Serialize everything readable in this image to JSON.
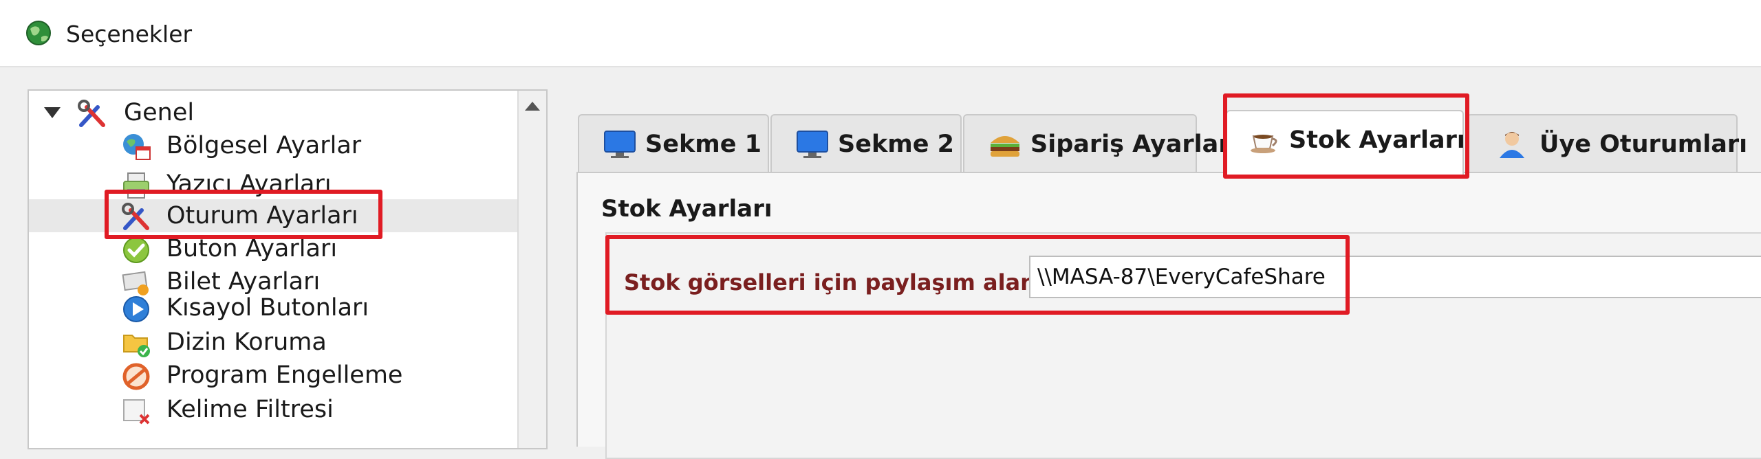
{
  "window": {
    "title": "Seçenekler"
  },
  "tree": {
    "root_label": "Genel",
    "items": [
      {
        "label": "Bölgesel Ayarlar",
        "icon": "globe-calendar-icon"
      },
      {
        "label": "Yazıcı Ayarları",
        "icon": "printer-icon"
      },
      {
        "label": "Oturum Ayarları",
        "icon": "tools-icon",
        "selected": true
      },
      {
        "label": "Buton Ayarları",
        "icon": "green-check-icon"
      },
      {
        "label": "Bilet Ayarları",
        "icon": "ticket-icon"
      },
      {
        "label": "Kısayol Butonları",
        "icon": "play-button-icon"
      },
      {
        "label": "Dizin Koruma",
        "icon": "folder-check-icon"
      },
      {
        "label": "Program Engelleme",
        "icon": "block-icon"
      },
      {
        "label": "Kelime Filtresi",
        "icon": "filter-x-icon"
      }
    ]
  },
  "tabs": [
    {
      "label": "Sekme 1",
      "icon": "monitor-icon"
    },
    {
      "label": "Sekme 2",
      "icon": "monitor-icon"
    },
    {
      "label": "Sipariş Ayarları",
      "icon": "burger-icon"
    },
    {
      "label": "Stok Ayarları",
      "icon": "coffee-cup-icon",
      "active": true
    },
    {
      "label": "Üye Oturumları",
      "icon": "user-icon"
    }
  ],
  "panel": {
    "title": "Stok Ayarları",
    "field_label": "Stok görselleri için paylaşım alanı",
    "field_value": "\\\\MASA-87\\EveryCafeShare"
  },
  "colors": {
    "highlight": "#e01b24",
    "label_text": "#7a1f1f"
  }
}
